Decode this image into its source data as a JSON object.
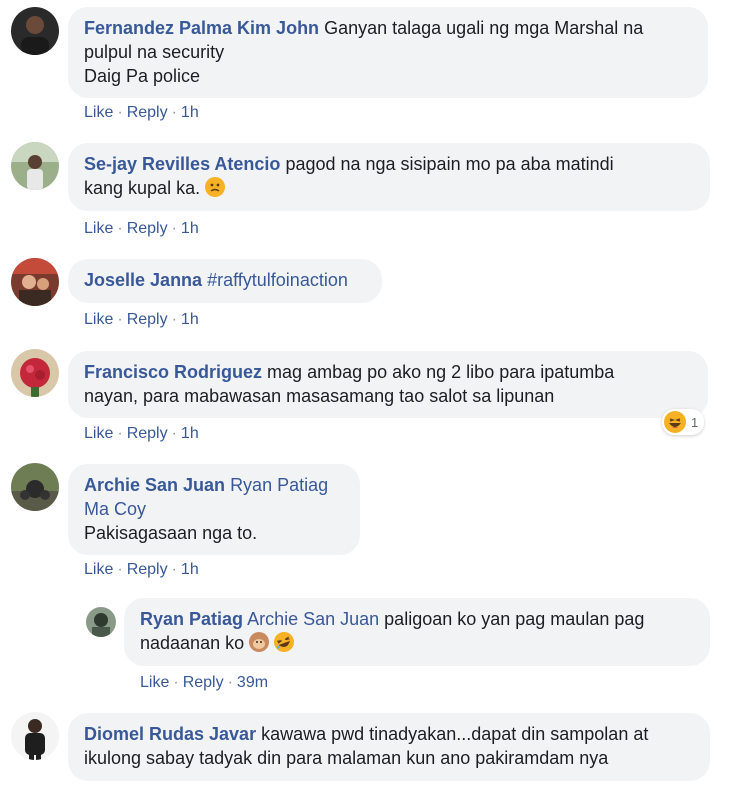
{
  "comments": [
    {
      "name": "Fernandez Palma Kim John",
      "text_line1": "Ganyan talaga ugali ng mga Marshal na",
      "text_line2": "pulpul na security",
      "text_line3": "Daig Pa police",
      "like": "Like",
      "reply": "Reply",
      "time": "1h"
    },
    {
      "name": "Se-jay Revilles Atencio",
      "text_line1": "pagod na nga sisipain mo pa aba matindi",
      "text_line2": "kang kupal ka.",
      "emoji": "frowning-face-emoji",
      "like": "Like",
      "reply": "Reply",
      "time": "1h"
    },
    {
      "name": "Joselle Janna",
      "hashtag": "#raffytulfoinaction",
      "like": "Like",
      "reply": "Reply",
      "time": "1h"
    },
    {
      "name": "Francisco Rodriguez",
      "text_line1": "mag ambag po ako ng 2 libo para ipatumba",
      "text_line2": "nayan, para mabawasan masasamang tao salot sa lipunan",
      "reaction_emoji": "haha-reaction-icon",
      "reaction_count": "1",
      "like": "Like",
      "reply": "Reply",
      "time": "1h"
    },
    {
      "name": "Archie San Juan",
      "mention_line1": "Ryan Patiag",
      "mention_line2": "Ma Coy",
      "text_line1": "Pakisagasaan nga to.",
      "like": "Like",
      "reply": "Reply",
      "time": "1h"
    },
    {
      "name": "Ryan Patiag",
      "mention": "Archie San Juan",
      "text_line1": "paligoan ko yan pag maulan pag",
      "text_line2": "nadaanan ko",
      "emojis": [
        "monkey-face-emoji",
        "rolling-laughing-emoji"
      ],
      "like": "Like",
      "reply": "Reply",
      "time": "39m"
    },
    {
      "name": "Diomel Rudas Javar",
      "text_line1": "kawawa pwd tinadyakan...dapat din sampolan at",
      "text_line2": "ikulong sabay tadyak din para malaman kun ano pakiramdam nya"
    }
  ],
  "colors": {
    "name": "#385898",
    "bubble": "#f2f3f5",
    "text": "#1c1e21",
    "separator": "#90949c"
  }
}
